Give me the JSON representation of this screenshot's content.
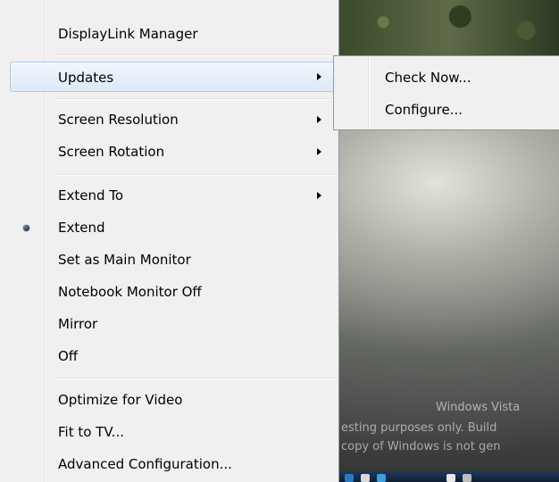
{
  "desktop": {
    "watermark_lines": [
      "Windows Vista",
      "esting purposes only. Build",
      "copy of Windows is not gen"
    ]
  },
  "context_menu": {
    "items": [
      {
        "label": "DisplayLink Manager"
      },
      {
        "label": "Updates",
        "has_submenu": true,
        "highlighted": true
      },
      {
        "label": "Screen Resolution",
        "has_submenu": true
      },
      {
        "label": "Screen Rotation",
        "has_submenu": true
      },
      {
        "label": "Extend To",
        "has_submenu": true
      },
      {
        "label": "Extend",
        "selected": true
      },
      {
        "label": "Set as Main Monitor"
      },
      {
        "label": "Notebook Monitor Off"
      },
      {
        "label": "Mirror"
      },
      {
        "label": "Off"
      },
      {
        "label": "Optimize for Video"
      },
      {
        "label": "Fit to TV..."
      },
      {
        "label": "Advanced Configuration..."
      }
    ]
  },
  "submenu": {
    "items": [
      {
        "label": "Check Now..."
      },
      {
        "label": "Configure..."
      }
    ]
  },
  "colors": {
    "menu_background": "#f0f0f0",
    "highlight_border": "#aecdf0",
    "highlight_fill": "#dde9f8"
  }
}
